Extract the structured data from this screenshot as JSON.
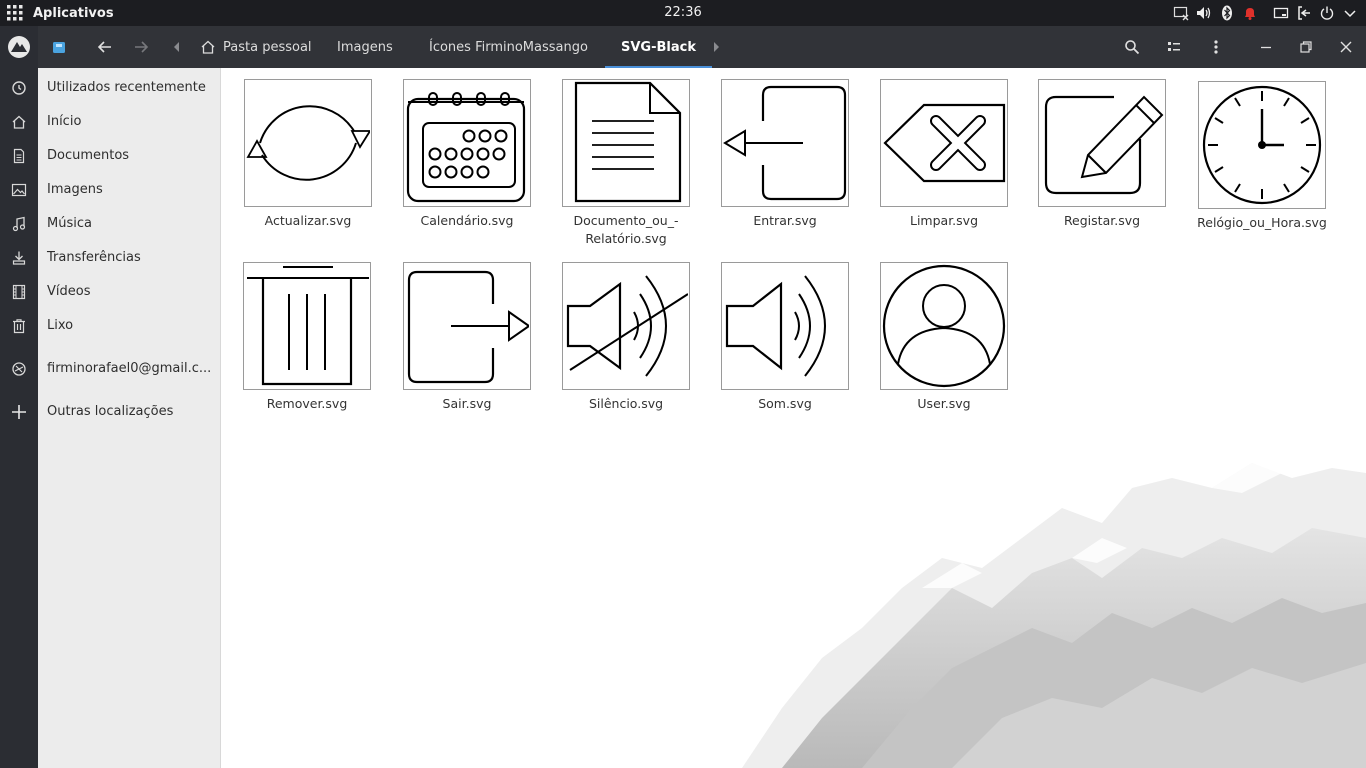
{
  "topbar": {
    "apps_label": "Aplicativos",
    "clock": "22:36",
    "tray_icons": [
      "screen-off-icon",
      "volume-icon",
      "bluetooth-icon",
      "notification-bell-icon",
      "display-icon",
      "logout-icon",
      "power-icon",
      "menu-chevron-icon"
    ]
  },
  "header": {
    "breadcrumbs": [
      "Pasta pessoal",
      "Imagens",
      "Ícones FirminoMassango",
      "SVG-Black"
    ],
    "active_index": 3,
    "accent_color": "#4a90d9"
  },
  "sidebar": {
    "items": [
      {
        "label": "Utilizados recentemente",
        "icon": "clock-icon"
      },
      {
        "label": "Início",
        "icon": "home-icon"
      },
      {
        "label": "Documentos",
        "icon": "document-icon"
      },
      {
        "label": "Imagens",
        "icon": "image-icon"
      },
      {
        "label": "Música",
        "icon": "music-icon"
      },
      {
        "label": "Transferências",
        "icon": "download-icon"
      },
      {
        "label": "Vídeos",
        "icon": "film-icon"
      },
      {
        "label": "Lixo",
        "icon": "trash-icon"
      },
      {
        "label": "firminorafael0@gmail.c...",
        "icon": "network-account-icon"
      },
      {
        "label": "Outras localizações",
        "icon": "plus-icon"
      }
    ]
  },
  "files": [
    {
      "name": "Actualizar.svg",
      "icon": "refresh-icon"
    },
    {
      "name": "Calendário.svg",
      "icon": "calendar-icon"
    },
    {
      "name": "Documento_ou_-Relatório.svg",
      "icon": "document-report-icon"
    },
    {
      "name": "Entrar.svg",
      "icon": "enter-icon"
    },
    {
      "name": "Limpar.svg",
      "icon": "clear-icon"
    },
    {
      "name": "Registar.svg",
      "icon": "register-edit-icon"
    },
    {
      "name": "Relógio_ou_Hora.svg",
      "icon": "wall-clock-icon"
    },
    {
      "name": "Remover.svg",
      "icon": "remove-trash-icon"
    },
    {
      "name": "Sair.svg",
      "icon": "exit-icon"
    },
    {
      "name": "Silêncio.svg",
      "icon": "mute-icon"
    },
    {
      "name": "Som.svg",
      "icon": "sound-icon"
    },
    {
      "name": "User.svg",
      "icon": "user-icon"
    }
  ]
}
